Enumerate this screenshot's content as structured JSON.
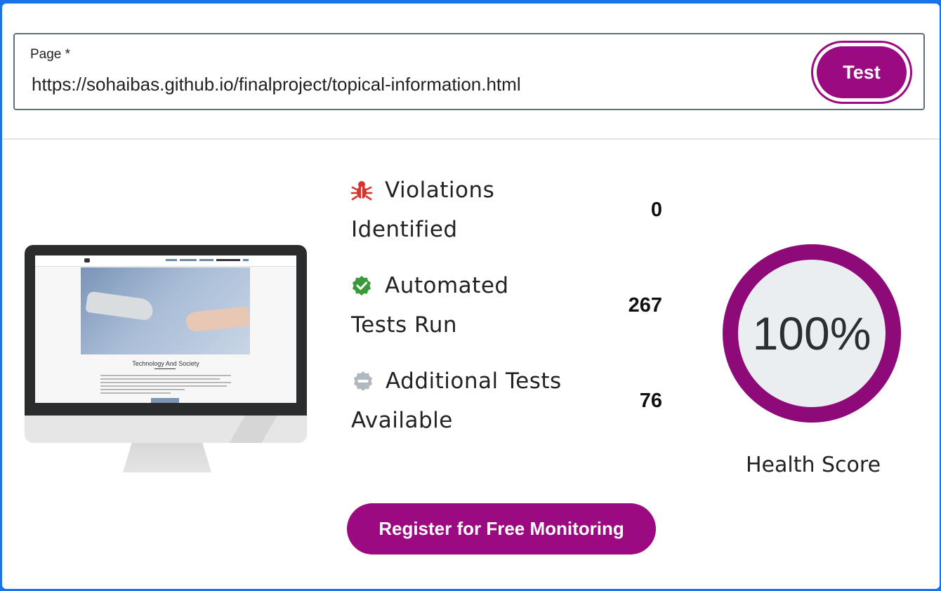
{
  "url_form": {
    "label": "Page *",
    "value": "https://sohaibas.github.io/finalproject/topical-information.html",
    "test_button": "Test"
  },
  "preview": {
    "title": "Technology And Society"
  },
  "stats": [
    {
      "icon": "bug-icon",
      "line1": "Violations",
      "line2": "Identified",
      "value": "0",
      "color": "#d9342b"
    },
    {
      "icon": "check-badge-icon",
      "line1": "Automated",
      "line2": "Tests Run",
      "value": "267",
      "color": "#3a9a3a"
    },
    {
      "icon": "minus-badge-icon",
      "line1": "Additional Tests",
      "line2": "Available",
      "value": "76",
      "color": "#b0b8c0"
    }
  ],
  "health": {
    "score_text": "100%",
    "score": 1.0,
    "label": "Health Score"
  },
  "register_button": "Register for Free Monitoring",
  "colors": {
    "accent": "#9b0a80",
    "background": "#1a73e8"
  }
}
